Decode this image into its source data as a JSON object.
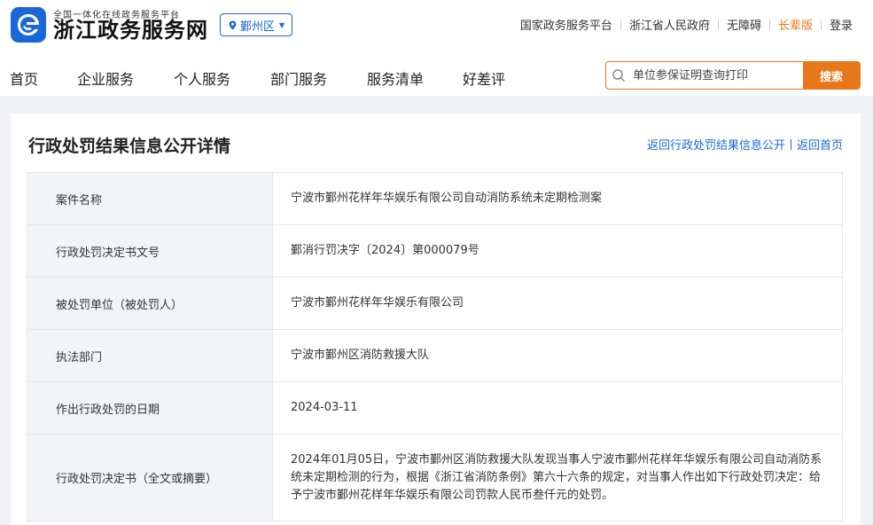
{
  "brand": {
    "subtitle": "全国一体化在线政务服务平台",
    "title": "浙江政务服务网"
  },
  "region": {
    "label": "鄞州区"
  },
  "toplinks": {
    "national": "国家政务服务平台",
    "province": "浙江省人民政府",
    "accessible": "无障碍",
    "elder": "长辈版",
    "login": "登录"
  },
  "nav": {
    "items": [
      "首页",
      "企业服务",
      "个人服务",
      "部门服务",
      "服务清单",
      "好差评"
    ]
  },
  "search": {
    "placeholder": "单位参保证明查询打印",
    "button": "搜索"
  },
  "page": {
    "title": "行政处罚结果信息公开详情",
    "back_list": "返回行政处罚结果信息公开",
    "back_home": "返回首页"
  },
  "detail": {
    "rows": [
      {
        "label": "案件名称",
        "value": "宁波市鄞州花样年华娱乐有限公司自动消防系统未定期检测案"
      },
      {
        "label": "行政处罚决定书文号",
        "value": "鄞消行罚决字〔2024〕第000079号"
      },
      {
        "label": "被处罚单位（被处罚人）",
        "value": "宁波市鄞州花样年华娱乐有限公司"
      },
      {
        "label": "执法部门",
        "value": "宁波市鄞州区消防救援大队"
      },
      {
        "label": "作出行政处罚的日期",
        "value": "2024-03-11"
      },
      {
        "label": "行政处罚决定书（全文或摘要）",
        "value": "2024年01月05日，宁波市鄞州区消防救援大队发现当事人宁波市鄞州花样年华娱乐有限公司自动消防系统未定期检测的行为，根据《浙江省消防条例》第六十六条的规定，对当事人作出如下行政处罚决定：给予宁波市鄞州花样年华娱乐有限公司罚款人民币叁仟元的处罚。"
      }
    ]
  },
  "colors": {
    "brand_blue": "#1a68d8",
    "accent_orange": "#e8771b"
  }
}
